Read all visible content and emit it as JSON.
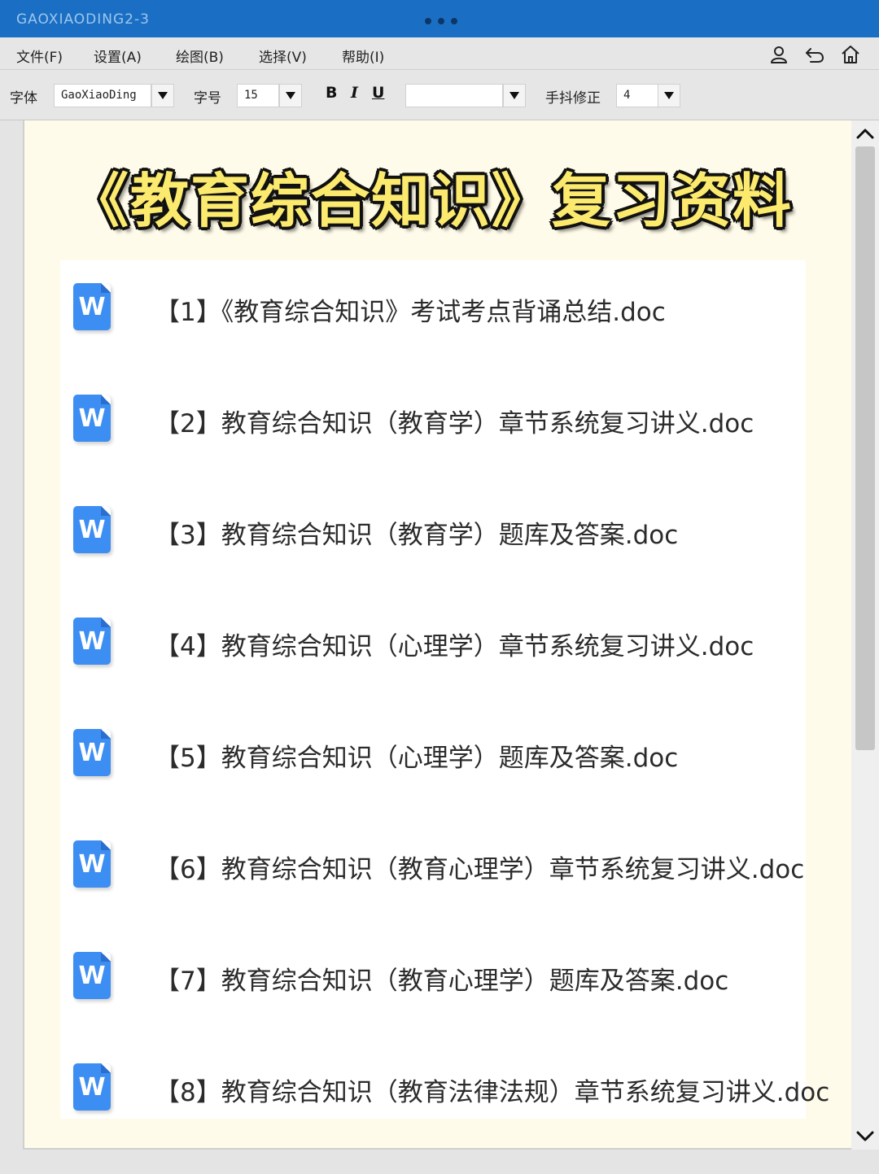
{
  "window": {
    "title": "GAOXIAODING2-3"
  },
  "menu": {
    "items": [
      "文件(F)",
      "设置(A)",
      "绘图(B)",
      "选择(V)",
      "帮助(I)"
    ],
    "icons": [
      "user-icon",
      "undo-icon",
      "home-icon"
    ]
  },
  "toolbar": {
    "font_label": "字体",
    "font_value": "GaoXiaoDing",
    "size_label": "字号",
    "size_value": "15",
    "bold": "B",
    "italic": "I",
    "underline": "U",
    "color_value": "",
    "jitter_label": "手抖修正",
    "jitter_value": "4"
  },
  "document": {
    "banner": "《教育综合知识》复习资料",
    "file_icon_letter": "W",
    "files": [
      "【1】《教育综合知识》考试考点背诵总结.doc",
      "【2】教育综合知识（教育学）章节系统复习讲义.doc",
      "【3】教育综合知识（教育学）题库及答案.doc",
      "【4】教育综合知识（心理学）章节系统复习讲义.doc",
      "【5】教育综合知识（心理学）题库及答案.doc",
      "【6】教育综合知识（教育心理学）章节系统复习讲义.doc",
      "【7】教育综合知识（教育心理学）题库及答案.doc",
      "【8】教育综合知识（教育法律法规）章节系统复习讲义.doc"
    ]
  },
  "colors": {
    "titlebar": "#1a6fc4",
    "banner_text": "#fbea6e",
    "word_icon": "#3d8ef2",
    "page_bg": "#fffbea"
  }
}
